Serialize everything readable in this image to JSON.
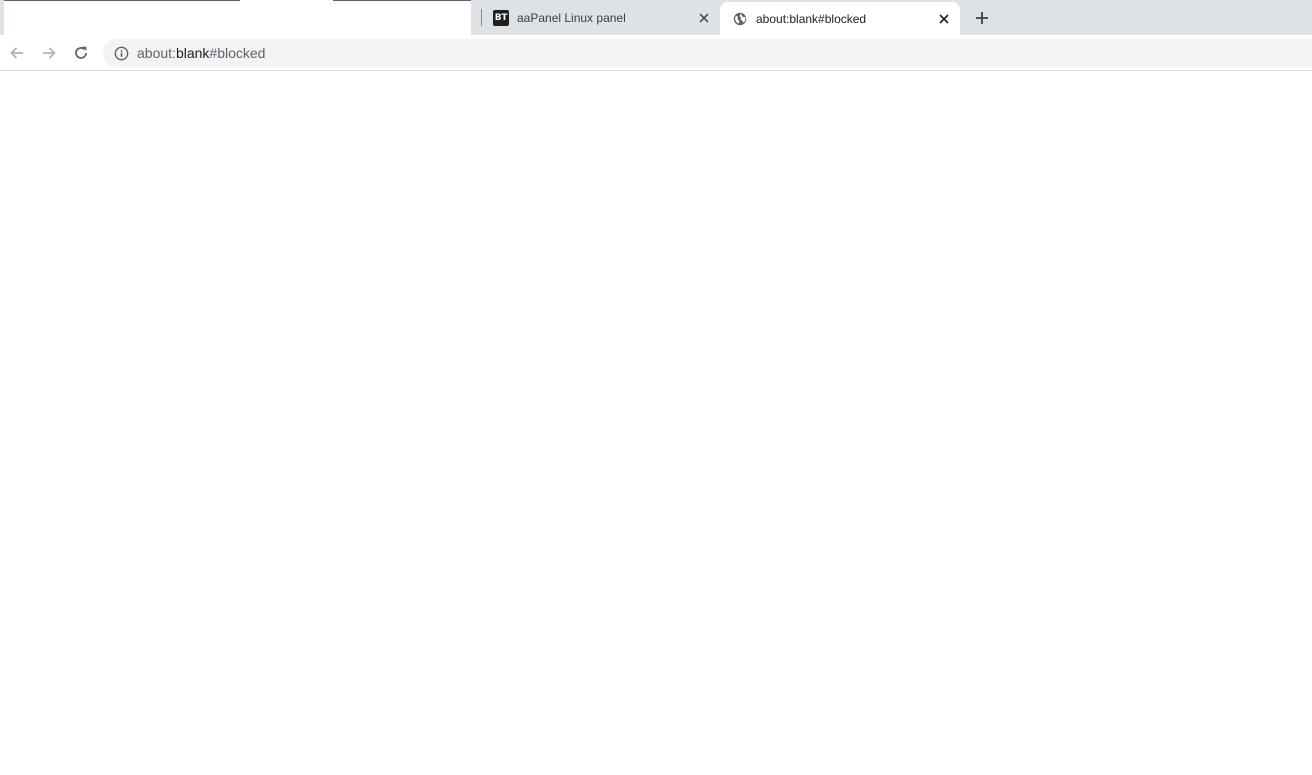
{
  "tabs": [
    {
      "title": "aaPanel Linux panel",
      "favicon": "BT",
      "active": false
    },
    {
      "title": "about:blank#blocked",
      "favicon": "globe-icon",
      "active": true
    }
  ],
  "omnibox": {
    "scheme": "about:",
    "host": "blank",
    "fragment": "#blocked"
  },
  "icons": {
    "back": "arrow-left-icon",
    "forward": "arrow-right-icon",
    "reload": "reload-icon",
    "info": "info-icon",
    "close": "close-icon",
    "new_tab": "plus-icon"
  },
  "colors": {
    "tabstrip": "#dee1e6",
    "omnibox": "#f1f3f4",
    "text": "#3c4043",
    "icon_disabled": "#b2b4b7",
    "icon": "#5f6368"
  }
}
